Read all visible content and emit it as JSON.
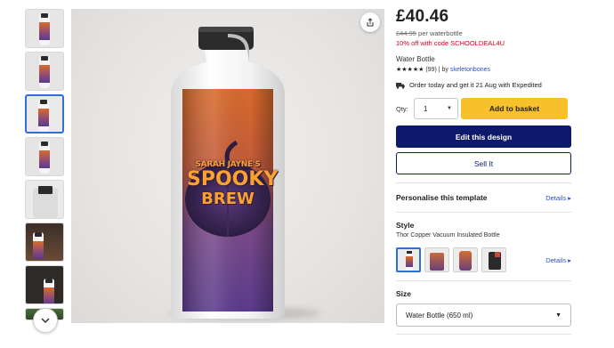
{
  "gallery": {
    "thumbnails": [
      {
        "name": "thumb-front-view"
      },
      {
        "name": "thumb-front-view-2"
      },
      {
        "name": "thumb-front-view-selected"
      },
      {
        "name": "thumb-side-view"
      },
      {
        "name": "thumb-cap-closeup"
      },
      {
        "name": "thumb-lifestyle-dark"
      },
      {
        "name": "thumb-lifestyle-warm"
      },
      {
        "name": "thumb-lifestyle-green"
      }
    ],
    "scroll_icon": "chevron-down-icon",
    "share_icon": "share-icon"
  },
  "product_image": {
    "line1": "SARAH JAYNE'S",
    "line2": "SPOOKY",
    "line3": "BREW"
  },
  "pricing": {
    "price": "£40.46",
    "old_price": "£44.95",
    "old_price_suffix": " per waterbottle",
    "promo": "10% off with code SCHOOLDEAL4U"
  },
  "product": {
    "title": "Water Bottle",
    "stars": "★★★★★",
    "rating_count": "(99)",
    "by_text": "| by ",
    "seller": "skeletonbones"
  },
  "delivery": {
    "icon": "truck-icon",
    "text": "Order today and get it 21 Aug with Expedited"
  },
  "purchase": {
    "qty_label": "Qty:",
    "qty_value": "1",
    "add_label": "Add to basket",
    "edit_label": "Edit this design",
    "sell_label": "Sell It"
  },
  "personalise": {
    "title": "Personalise this template",
    "details": "Details ▸"
  },
  "style": {
    "title": "Style",
    "value": "Thor Copper Vacuum Insulated Bottle",
    "details": "Details ▸",
    "options": [
      "thor-copper",
      "pint-glass-style",
      "sport-bottle",
      "tumbler"
    ]
  },
  "size": {
    "title": "Size",
    "value": "Water Bottle (650 ml)"
  },
  "colors": {
    "accent_navy": "#0d1a6b",
    "add_yellow": "#f8c12b",
    "promo_red": "#d4001f",
    "link_blue": "#2a53c4"
  }
}
